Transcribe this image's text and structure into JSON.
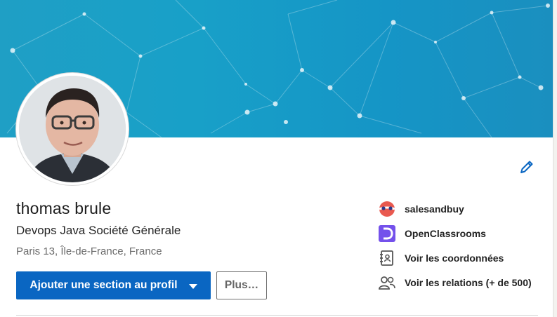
{
  "profile": {
    "name": "thomas brule",
    "headline": "Devops Java Société Générale",
    "location": "Paris 13, Île-de-France, France"
  },
  "actions": {
    "add_section_label": "Ajouter une section au profil",
    "more_label": "Plus…"
  },
  "right_panel": {
    "company": "salesandbuy",
    "school": "OpenClassrooms",
    "contact_info": "Voir les coordonnées",
    "connections": "Voir les relations (+ de 500)"
  },
  "icons": {
    "edit": "pencil-icon",
    "company": "salesandbuy-logo",
    "school": "openclassrooms-logo",
    "contact": "contact-card-icon",
    "connections": "people-icon"
  },
  "colors": {
    "banner": "#18a0c8",
    "primary_button": "#0a66c2",
    "edit_icon": "#0a66c2",
    "school_logo": "#7451eb",
    "company_logo": "#e9594f"
  }
}
